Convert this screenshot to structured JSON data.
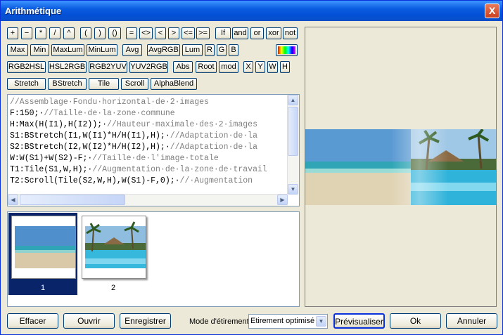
{
  "window": {
    "title": "Arithmétique",
    "close": "X"
  },
  "ops_row1": [
    "+",
    "−",
    "*",
    "/",
    "^",
    "(",
    ")",
    "()",
    "=",
    "<>",
    "<",
    ">",
    "<=",
    ">=",
    "If",
    "and",
    "or",
    "xor",
    "not"
  ],
  "funcs_row2": [
    "Max",
    "Min",
    "MaxLum",
    "MinLum",
    "Avg",
    "AvgRGB",
    "Lum",
    "R",
    "G",
    "B"
  ],
  "funcs_row3": [
    "RGB2HSL",
    "HSL2RGB",
    "RGB2YUV",
    "YUV2RGB",
    "Abs",
    "Root",
    "mod",
    "X",
    "Y",
    "W",
    "H"
  ],
  "funcs_row4": [
    "Stretch",
    "BStretch",
    "Tile",
    "Scroll",
    "AlphaBlend"
  ],
  "code": [
    {
      "code": "",
      "comment": "//Assemblage·Fondu·horizontal·de·2·images"
    },
    {
      "code": "F:150;·",
      "comment": "//Taille·de·la·zone·commune"
    },
    {
      "code": "H:Max(H(I1),H(I2));·",
      "comment": "//Hauteur·maximale·des·2·images"
    },
    {
      "code": "S1:BStretch(I1,W(I1)*H/H(I1),H);·",
      "comment": "//Adaptation·de·la"
    },
    {
      "code": "S2:BStretch(I2,W(I2)*H/H(I2),H);·",
      "comment": "//Adaptation·de·la"
    },
    {
      "code": "W:W(S1)+W(S2)-F;·",
      "comment": "//Taille·de·l'image·totale"
    },
    {
      "code": "T1:Tile(S1,W,H);·",
      "comment": "//Augmentation·de·la·zone·de·travail"
    },
    {
      "code": "T2:Scroll(Tile(S2,W,H),W(S1)-F,0);·",
      "comment": "//·Augmentation"
    }
  ],
  "thumbnails": [
    {
      "label": "1"
    },
    {
      "label": "2"
    }
  ],
  "footer": {
    "clear": "Effacer",
    "open": "Ouvrir",
    "save": "Enregistrer",
    "stretch_mode_label": "Mode d'étirement",
    "stretch_mode_value": "Etirement optimisé",
    "preview": "Prévisualiser",
    "ok": "Ok",
    "cancel": "Annuler"
  },
  "colors": {
    "title_bar": "#0a5ce0",
    "selection": "#0a246a",
    "face": "#ece9d8"
  }
}
